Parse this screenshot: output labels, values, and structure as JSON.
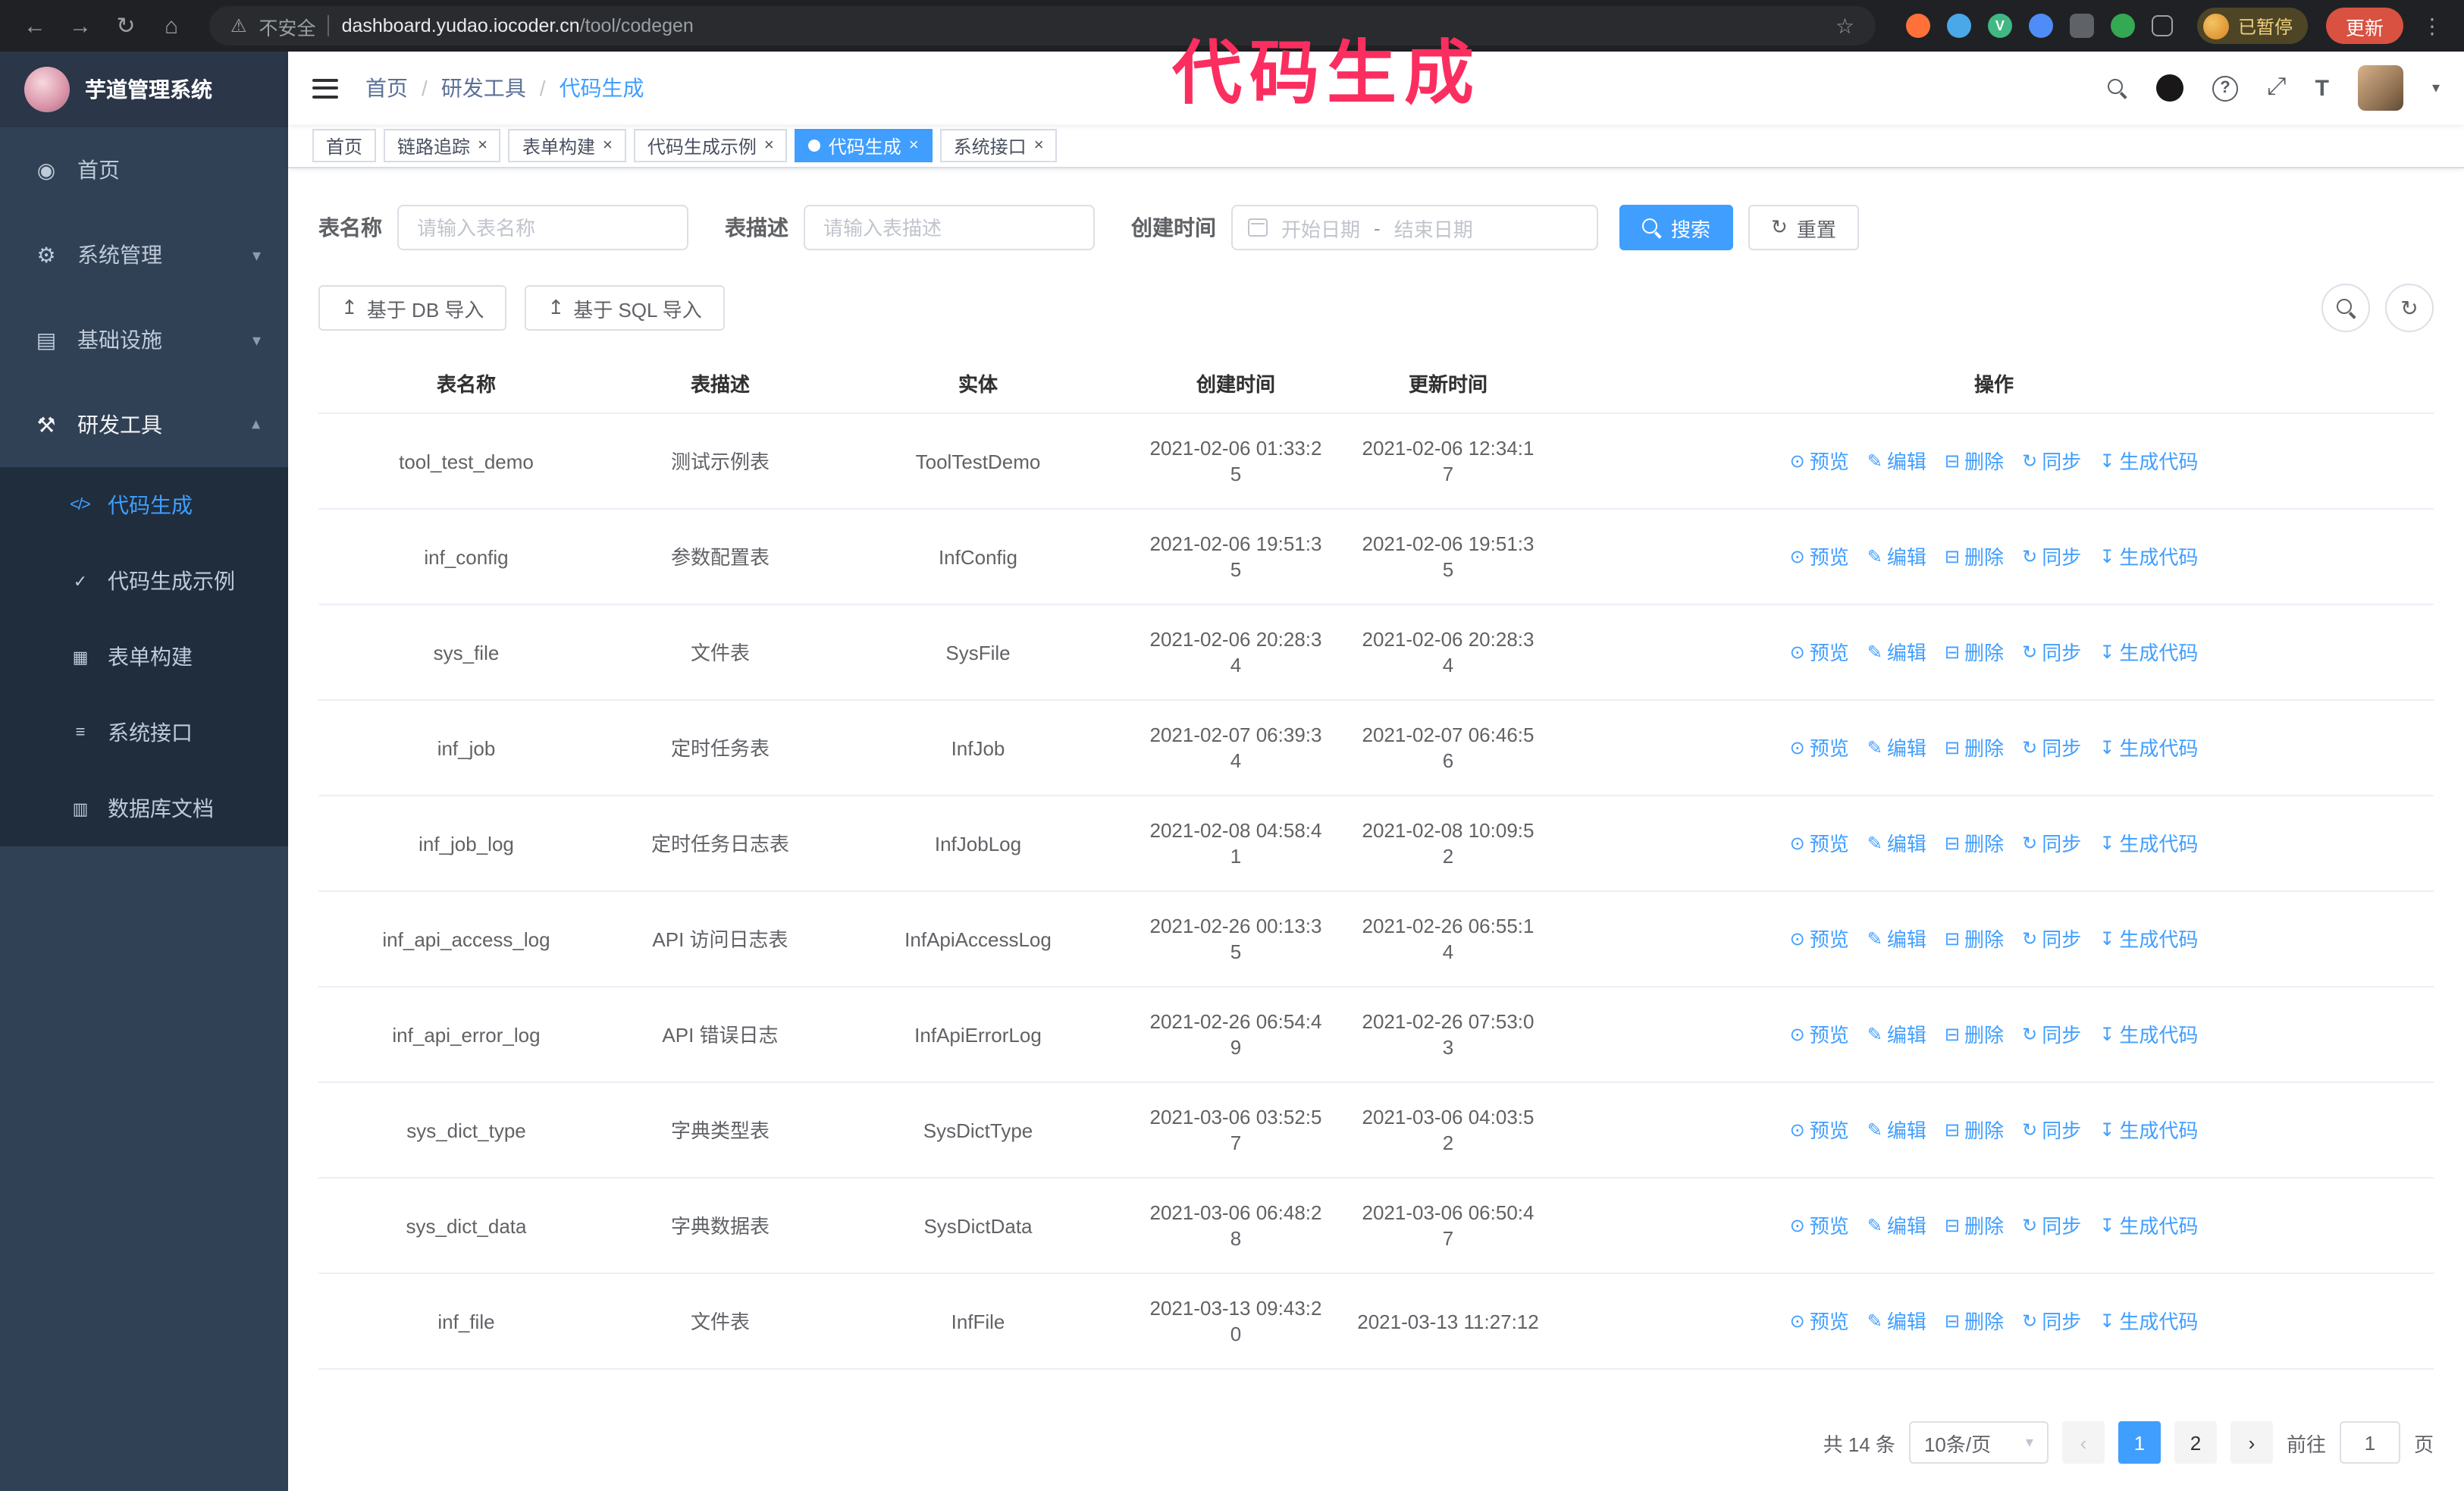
{
  "colors": {
    "accent": "#409EFF",
    "sidebar_bg": "#304156",
    "submenu_bg": "#1f2d3d",
    "annotation_pink": "#fb2e5f",
    "update_button_bg": "#d95140"
  },
  "icons": {
    "back": "←",
    "forward": "→",
    "reload": "↻",
    "home": "⌂",
    "warning": "⚠",
    "star": "☆",
    "dots": "⋮",
    "vue": "V",
    "help": "?",
    "fullscreen": "⤢",
    "font_size": "T",
    "caret_down": "▾",
    "slash": "/",
    "refresh": "↻",
    "upload": "↥"
  },
  "browser": {
    "security_warning": "不安全",
    "url_host": "dashboard.yudao.iocoder.cn",
    "url_path": "/tool/codegen",
    "paused_badge": "已暂停",
    "update_button": "更新"
  },
  "annotation": {
    "text": "代码生成"
  },
  "sidebar": {
    "logo_title": "芋道管理系统",
    "menu": [
      {
        "icon": "◉",
        "icon_name": "dashboard-icon",
        "label": "首页",
        "type": "item",
        "expanded": false
      },
      {
        "icon": "⚙",
        "icon_name": "gear-icon",
        "label": "系统管理",
        "type": "submenu",
        "expanded": false
      },
      {
        "icon": "▤",
        "icon_name": "infrastructure-icon",
        "label": "基础设施",
        "type": "submenu",
        "expanded": false
      },
      {
        "icon": "⚒",
        "icon_name": "tools-icon",
        "label": "研发工具",
        "type": "submenu",
        "expanded": true,
        "children": [
          {
            "icon": "</>",
            "icon_name": "code-icon",
            "label": "代码生成",
            "active": true
          },
          {
            "icon": "✓",
            "icon_name": "example-icon",
            "label": "代码生成示例",
            "active": false
          },
          {
            "icon": "▦",
            "icon_name": "form-builder-icon",
            "label": "表单构建",
            "active": false
          },
          {
            "icon": "≡",
            "icon_name": "api-icon",
            "label": "系统接口",
            "active": false
          },
          {
            "icon": "▥",
            "icon_name": "db-doc-icon",
            "label": "数据库文档",
            "active": false
          }
        ]
      }
    ]
  },
  "navbar": {
    "breadcrumb": [
      {
        "label": "首页"
      },
      {
        "label": "研发工具"
      },
      {
        "label": "代码生成"
      }
    ]
  },
  "tabs": [
    {
      "label": "首页",
      "closable": false,
      "active": false
    },
    {
      "label": "链路追踪",
      "closable": true,
      "active": false
    },
    {
      "label": "表单构建",
      "closable": true,
      "active": false
    },
    {
      "label": "代码生成示例",
      "closable": true,
      "active": false
    },
    {
      "label": "代码生成",
      "closable": true,
      "active": true
    },
    {
      "label": "系统接口",
      "closable": true,
      "active": false
    }
  ],
  "filters": {
    "table_name_label": "表名称",
    "table_name_placeholder": "请输入表名称",
    "table_desc_label": "表描述",
    "table_desc_placeholder": "请输入表描述",
    "create_time_label": "创建时间",
    "start_date_placeholder": "开始日期",
    "range_separator": "-",
    "end_date_placeholder": "结束日期",
    "search_button": "搜索",
    "reset_button": "重置"
  },
  "toolbar": {
    "import_db": "基于 DB 导入",
    "import_sql": "基于 SQL 导入"
  },
  "table": {
    "columns": [
      "表名称",
      "表描述",
      "实体",
      "创建时间",
      "更新时间",
      "操作"
    ],
    "actions": [
      {
        "key": "preview",
        "icon": "⊙",
        "label": "预览"
      },
      {
        "key": "edit",
        "icon": "✎",
        "label": "编辑"
      },
      {
        "key": "delete",
        "icon": "⊟",
        "label": "删除"
      },
      {
        "key": "sync",
        "icon": "↻",
        "label": "同步"
      },
      {
        "key": "generate",
        "icon": "↧",
        "label": "生成代码"
      }
    ],
    "rows": [
      {
        "name": "tool_test_demo",
        "desc": "测试示例表",
        "entity": "ToolTestDemo",
        "created": "2021-02-06 01:33:25",
        "updated": "2021-02-06 12:34:17"
      },
      {
        "name": "inf_config",
        "desc": "参数配置表",
        "entity": "InfConfig",
        "created": "2021-02-06 19:51:35",
        "updated": "2021-02-06 19:51:35"
      },
      {
        "name": "sys_file",
        "desc": "文件表",
        "entity": "SysFile",
        "created": "2021-02-06 20:28:34",
        "updated": "2021-02-06 20:28:34"
      },
      {
        "name": "inf_job",
        "desc": "定时任务表",
        "entity": "InfJob",
        "created": "2021-02-07 06:39:34",
        "updated": "2021-02-07 06:46:56"
      },
      {
        "name": "inf_job_log",
        "desc": "定时任务日志表",
        "entity": "InfJobLog",
        "created": "2021-02-08 04:58:41",
        "updated": "2021-02-08 10:09:52"
      },
      {
        "name": "inf_api_access_log",
        "desc": "API 访问日志表",
        "entity": "InfApiAccessLog",
        "created": "2021-02-26 00:13:35",
        "updated": "2021-02-26 06:55:14"
      },
      {
        "name": "inf_api_error_log",
        "desc": "API 错误日志",
        "entity": "InfApiErrorLog",
        "created": "2021-02-26 06:54:49",
        "updated": "2021-02-26 07:53:03"
      },
      {
        "name": "sys_dict_type",
        "desc": "字典类型表",
        "entity": "SysDictType",
        "created": "2021-03-06 03:52:57",
        "updated": "2021-03-06 04:03:52"
      },
      {
        "name": "sys_dict_data",
        "desc": "字典数据表",
        "entity": "SysDictData",
        "created": "2021-03-06 06:48:28",
        "updated": "2021-03-06 06:50:47"
      },
      {
        "name": "inf_file",
        "desc": "文件表",
        "entity": "InfFile",
        "created": "2021-03-13 09:43:20",
        "updated": "2021-03-13 11:27:12"
      }
    ]
  },
  "pagination": {
    "total": "共 14 条",
    "page_size": "10条/页",
    "prev": "‹",
    "next": "›",
    "pages": [
      {
        "label": "1",
        "active": true
      },
      {
        "label": "2",
        "active": false
      }
    ],
    "goto_label": "前往",
    "goto_value": "1",
    "unit_label": "页"
  }
}
